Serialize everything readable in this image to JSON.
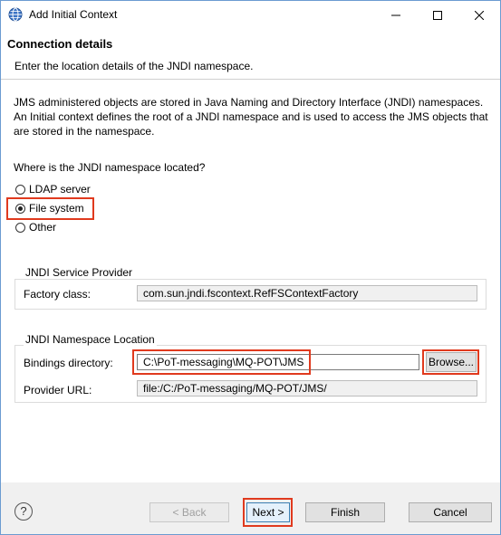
{
  "window": {
    "title": "Add Initial Context",
    "minimize_icon": "minimize-icon",
    "maximize_icon": "maximize-icon",
    "close_icon": "close-icon"
  },
  "header": {
    "title": "Connection details",
    "description": "Enter the location details of the JNDI namespace."
  },
  "intro": "JMS administered objects are stored in Java Naming and Directory Interface (JNDI) namespaces. An Initial context defines the root of a JNDI namespace and is used to access the JMS objects that are stored in the namespace.",
  "location": {
    "question": "Where is the JNDI namespace located?",
    "options": [
      {
        "label": "LDAP server",
        "selected": false
      },
      {
        "label": "File system",
        "selected": true
      },
      {
        "label": "Other",
        "selected": false
      }
    ]
  },
  "service_provider": {
    "group_title": "JNDI Service Provider",
    "factory_label": "Factory class:",
    "factory_value": "com.sun.jndi.fscontext.RefFSContextFactory"
  },
  "namespace_location": {
    "group_title": "JNDI Namespace Location",
    "bindings_label": "Bindings directory:",
    "bindings_value": "C:\\PoT-messaging\\MQ-POT\\JMS",
    "browse_label": "Browse...",
    "provider_label": "Provider URL:",
    "provider_value": "file:/C:/PoT-messaging/MQ-POT/JMS/"
  },
  "footer": {
    "help_icon": "help-icon",
    "help_glyph": "?",
    "back_label": "< Back",
    "next_label": "Next >",
    "finish_label": "Finish",
    "cancel_label": "Cancel"
  },
  "colors": {
    "highlight": "#e03a1e",
    "window_border": "#6b9bd1",
    "primary_button_border": "#3c7fb1"
  }
}
